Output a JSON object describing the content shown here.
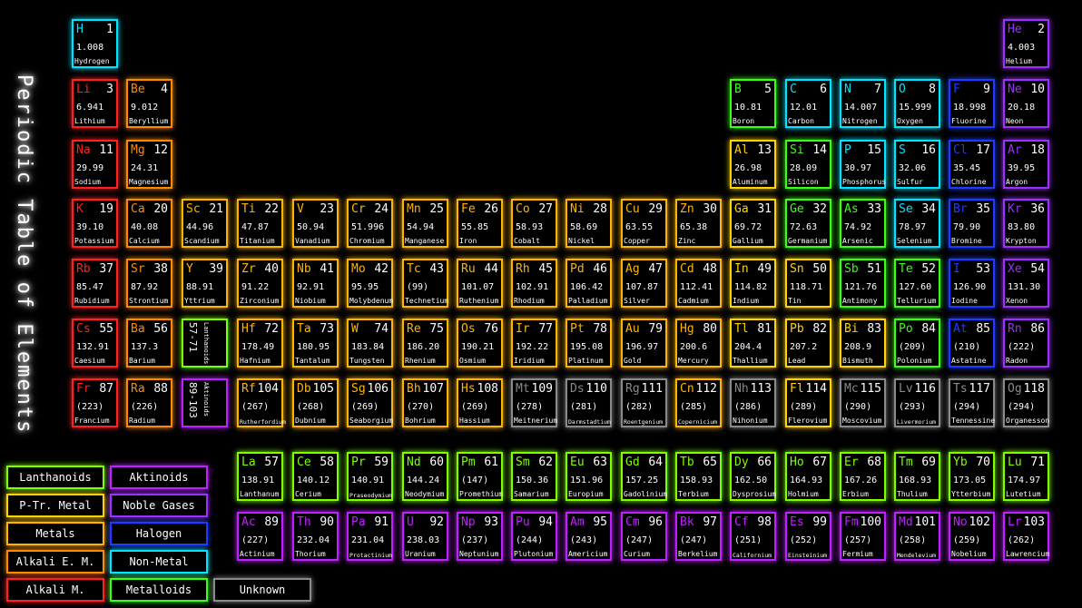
{
  "title": "Periodic Table of Elements",
  "colors": {
    "hydrogen": "#00e5ff",
    "alkali": "#ff2020",
    "alkaline": "#ff8a00",
    "metal": "#ffb400",
    "ptrmetal": "#ffd400",
    "metalloid": "#39ff14",
    "nonmetal": "#00e5ff",
    "halogen": "#1e3cff",
    "noble": "#9b30ff",
    "lanth": "#7dff00",
    "actin": "#c020ff",
    "unknown": "#8a8a8a"
  },
  "elements": [
    {
      "sym": "H",
      "num": "1",
      "mass": "1.008",
      "name": "Hydrogen",
      "cat": "hydrogen"
    },
    {
      "sym": "He",
      "num": "2",
      "mass": "4.003",
      "name": "Helium",
      "cat": "noble"
    },
    {
      "sym": "Li",
      "num": "3",
      "mass": "6.941",
      "name": "Lithium",
      "cat": "alkali"
    },
    {
      "sym": "Be",
      "num": "4",
      "mass": "9.012",
      "name": "Beryllium",
      "cat": "alkaline"
    },
    {
      "sym": "B",
      "num": "5",
      "mass": "10.81",
      "name": "Boron",
      "cat": "metalloid"
    },
    {
      "sym": "C",
      "num": "6",
      "mass": "12.01",
      "name": "Carbon",
      "cat": "nonmetal"
    },
    {
      "sym": "N",
      "num": "7",
      "mass": "14.007",
      "name": "Nitrogen",
      "cat": "nonmetal"
    },
    {
      "sym": "O",
      "num": "8",
      "mass": "15.999",
      "name": "Oxygen",
      "cat": "nonmetal"
    },
    {
      "sym": "F",
      "num": "9",
      "mass": "18.998",
      "name": "Fluorine",
      "cat": "halogen"
    },
    {
      "sym": "Ne",
      "num": "10",
      "mass": "20.18",
      "name": "Neon",
      "cat": "noble"
    },
    {
      "sym": "Na",
      "num": "11",
      "mass": "29.99",
      "name": "Sodium",
      "cat": "alkali"
    },
    {
      "sym": "Mg",
      "num": "12",
      "mass": "24.31",
      "name": "Magnesium",
      "cat": "alkaline"
    },
    {
      "sym": "Al",
      "num": "13",
      "mass": "26.98",
      "name": "Aluminum",
      "cat": "ptrmetal"
    },
    {
      "sym": "Si",
      "num": "14",
      "mass": "28.09",
      "name": "Silicon",
      "cat": "metalloid"
    },
    {
      "sym": "P",
      "num": "15",
      "mass": "30.97",
      "name": "Phosphorus",
      "cat": "nonmetal"
    },
    {
      "sym": "S",
      "num": "16",
      "mass": "32.06",
      "name": "Sulfur",
      "cat": "nonmetal"
    },
    {
      "sym": "Cl",
      "num": "17",
      "mass": "35.45",
      "name": "Chlorine",
      "cat": "halogen"
    },
    {
      "sym": "Ar",
      "num": "18",
      "mass": "39.95",
      "name": "Argon",
      "cat": "noble"
    },
    {
      "sym": "K",
      "num": "19",
      "mass": "39.10",
      "name": "Potassium",
      "cat": "alkali"
    },
    {
      "sym": "Ca",
      "num": "20",
      "mass": "40.08",
      "name": "Calcium",
      "cat": "alkaline"
    },
    {
      "sym": "Sc",
      "num": "21",
      "mass": "44.96",
      "name": "Scandium",
      "cat": "metal"
    },
    {
      "sym": "Ti",
      "num": "22",
      "mass": "47.87",
      "name": "Titanium",
      "cat": "metal"
    },
    {
      "sym": "V",
      "num": "23",
      "mass": "50.94",
      "name": "Vanadium",
      "cat": "metal"
    },
    {
      "sym": "Cr",
      "num": "24",
      "mass": "51.996",
      "name": "Chromium",
      "cat": "metal"
    },
    {
      "sym": "Mn",
      "num": "25",
      "mass": "54.94",
      "name": "Manganese",
      "cat": "metal"
    },
    {
      "sym": "Fe",
      "num": "26",
      "mass": "55.85",
      "name": "Iron",
      "cat": "metal"
    },
    {
      "sym": "Co",
      "num": "27",
      "mass": "58.93",
      "name": "Cobalt",
      "cat": "metal"
    },
    {
      "sym": "Ni",
      "num": "28",
      "mass": "58.69",
      "name": "Nickel",
      "cat": "metal"
    },
    {
      "sym": "Cu",
      "num": "29",
      "mass": "63.55",
      "name": "Copper",
      "cat": "metal"
    },
    {
      "sym": "Zn",
      "num": "30",
      "mass": "65.38",
      "name": "Zinc",
      "cat": "metal"
    },
    {
      "sym": "Ga",
      "num": "31",
      "mass": "69.72",
      "name": "Gallium",
      "cat": "ptrmetal"
    },
    {
      "sym": "Ge",
      "num": "32",
      "mass": "72.63",
      "name": "Germanium",
      "cat": "metalloid"
    },
    {
      "sym": "As",
      "num": "33",
      "mass": "74.92",
      "name": "Arsenic",
      "cat": "metalloid"
    },
    {
      "sym": "Se",
      "num": "34",
      "mass": "78.97",
      "name": "Selenium",
      "cat": "nonmetal"
    },
    {
      "sym": "Br",
      "num": "35",
      "mass": "79.90",
      "name": "Bromine",
      "cat": "halogen"
    },
    {
      "sym": "Kr",
      "num": "36",
      "mass": "83.80",
      "name": "Krypton",
      "cat": "noble"
    },
    {
      "sym": "Rb",
      "num": "37",
      "mass": "85.47",
      "name": "Rubidium",
      "cat": "alkali"
    },
    {
      "sym": "Sr",
      "num": "38",
      "mass": "87.92",
      "name": "Strontium",
      "cat": "alkaline"
    },
    {
      "sym": "Y",
      "num": "39",
      "mass": "88.91",
      "name": "Yttrium",
      "cat": "metal"
    },
    {
      "sym": "Zr",
      "num": "40",
      "mass": "91.22",
      "name": "Zirconium",
      "cat": "metal"
    },
    {
      "sym": "Nb",
      "num": "41",
      "mass": "92.91",
      "name": "Niobium",
      "cat": "metal"
    },
    {
      "sym": "Mo",
      "num": "42",
      "mass": "95.95",
      "name": "Molybdenum",
      "cat": "metal"
    },
    {
      "sym": "Tc",
      "num": "43",
      "mass": "(99)",
      "name": "Technetium",
      "cat": "metal"
    },
    {
      "sym": "Ru",
      "num": "44",
      "mass": "101.07",
      "name": "Ruthenium",
      "cat": "metal"
    },
    {
      "sym": "Rh",
      "num": "45",
      "mass": "102.91",
      "name": "Rhodium",
      "cat": "metal"
    },
    {
      "sym": "Pd",
      "num": "46",
      "mass": "106.42",
      "name": "Palladium",
      "cat": "metal"
    },
    {
      "sym": "Ag",
      "num": "47",
      "mass": "107.87",
      "name": "Silver",
      "cat": "metal"
    },
    {
      "sym": "Cd",
      "num": "48",
      "mass": "112.41",
      "name": "Cadmium",
      "cat": "metal"
    },
    {
      "sym": "In",
      "num": "49",
      "mass": "114.82",
      "name": "Indium",
      "cat": "ptrmetal"
    },
    {
      "sym": "Sn",
      "num": "50",
      "mass": "118.71",
      "name": "Tin",
      "cat": "ptrmetal"
    },
    {
      "sym": "Sb",
      "num": "51",
      "mass": "121.76",
      "name": "Antimony",
      "cat": "metalloid"
    },
    {
      "sym": "Te",
      "num": "52",
      "mass": "127.60",
      "name": "Tellurium",
      "cat": "metalloid"
    },
    {
      "sym": "I",
      "num": "53",
      "mass": "126.90",
      "name": "Iodine",
      "cat": "halogen"
    },
    {
      "sym": "Xe",
      "num": "54",
      "mass": "131.30",
      "name": "Xenon",
      "cat": "noble"
    },
    {
      "sym": "Cs",
      "num": "55",
      "mass": "132.91",
      "name": "Caesium",
      "cat": "alkali"
    },
    {
      "sym": "Ba",
      "num": "56",
      "mass": "137.3",
      "name": "Barium",
      "cat": "alkaline"
    },
    {
      "sym": "57-71",
      "name": "Lanthanoids",
      "cat": "lanth",
      "vertical": true
    },
    {
      "sym": "Hf",
      "num": "72",
      "mass": "178.49",
      "name": "Hafnium",
      "cat": "metal"
    },
    {
      "sym": "Ta",
      "num": "73",
      "mass": "180.95",
      "name": "Tantalum",
      "cat": "metal"
    },
    {
      "sym": "W",
      "num": "74",
      "mass": "183.84",
      "name": "Tungsten",
      "cat": "metal"
    },
    {
      "sym": "Re",
      "num": "75",
      "mass": "186.20",
      "name": "Rhenium",
      "cat": "metal"
    },
    {
      "sym": "Os",
      "num": "76",
      "mass": "190.21",
      "name": "Osmium",
      "cat": "metal"
    },
    {
      "sym": "Ir",
      "num": "77",
      "mass": "192.22",
      "name": "Iridium",
      "cat": "metal"
    },
    {
      "sym": "Pt",
      "num": "78",
      "mass": "195.08",
      "name": "Platinum",
      "cat": "metal"
    },
    {
      "sym": "Au",
      "num": "79",
      "mass": "196.97",
      "name": "Gold",
      "cat": "metal"
    },
    {
      "sym": "Hg",
      "num": "80",
      "mass": "200.6",
      "name": "Mercury",
      "cat": "metal"
    },
    {
      "sym": "Tl",
      "num": "81",
      "mass": "204.4",
      "name": "Thallium",
      "cat": "ptrmetal"
    },
    {
      "sym": "Pb",
      "num": "82",
      "mass": "207.2",
      "name": "Lead",
      "cat": "ptrmetal"
    },
    {
      "sym": "Bi",
      "num": "83",
      "mass": "208.9",
      "name": "Bismuth",
      "cat": "ptrmetal"
    },
    {
      "sym": "Po",
      "num": "84",
      "mass": "(209)",
      "name": "Polonium",
      "cat": "metalloid"
    },
    {
      "sym": "At",
      "num": "85",
      "mass": "(210)",
      "name": "Astatine",
      "cat": "halogen"
    },
    {
      "sym": "Rn",
      "num": "86",
      "mass": "(222)",
      "name": "Radon",
      "cat": "noble"
    },
    {
      "sym": "Fr",
      "num": "87",
      "mass": "(223)",
      "name": "Francium",
      "cat": "alkali"
    },
    {
      "sym": "Ra",
      "num": "88",
      "mass": "(226)",
      "name": "Radium",
      "cat": "alkaline"
    },
    {
      "sym": "89-103",
      "name": "Aktinoids",
      "cat": "actin",
      "vertical": true
    },
    {
      "sym": "Rf",
      "num": "104",
      "mass": "(267)",
      "name": "Rutherfordium",
      "cat": "metal"
    },
    {
      "sym": "Db",
      "num": "105",
      "mass": "(268)",
      "name": "Dubnium",
      "cat": "metal"
    },
    {
      "sym": "Sg",
      "num": "106",
      "mass": "(269)",
      "name": "Seaborgium",
      "cat": "metal"
    },
    {
      "sym": "Bh",
      "num": "107",
      "mass": "(270)",
      "name": "Bohrium",
      "cat": "metal"
    },
    {
      "sym": "Hs",
      "num": "108",
      "mass": "(269)",
      "name": "Hassium",
      "cat": "metal"
    },
    {
      "sym": "Mt",
      "num": "109",
      "mass": "(278)",
      "name": "Meitnerium",
      "cat": "unknown"
    },
    {
      "sym": "Ds",
      "num": "110",
      "mass": "(281)",
      "name": "Darmstadtium",
      "cat": "unknown"
    },
    {
      "sym": "Rg",
      "num": "111",
      "mass": "(282)",
      "name": "Roentgenium",
      "cat": "unknown"
    },
    {
      "sym": "Cn",
      "num": "112",
      "mass": "(285)",
      "name": "Copernicium",
      "cat": "metal"
    },
    {
      "sym": "Nh",
      "num": "113",
      "mass": "(286)",
      "name": "Nihonium",
      "cat": "unknown"
    },
    {
      "sym": "Fl",
      "num": "114",
      "mass": "(289)",
      "name": "Flerovium",
      "cat": "ptrmetal"
    },
    {
      "sym": "Mc",
      "num": "115",
      "mass": "(290)",
      "name": "Moscovium",
      "cat": "unknown"
    },
    {
      "sym": "Lv",
      "num": "116",
      "mass": "(293)",
      "name": "Livermorium",
      "cat": "unknown"
    },
    {
      "sym": "Ts",
      "num": "117",
      "mass": "(294)",
      "name": "Tennessine",
      "cat": "unknown"
    },
    {
      "sym": "Og",
      "num": "118",
      "mass": "(294)",
      "name": "Organesson",
      "cat": "unknown"
    },
    {
      "sym": "La",
      "num": "57",
      "mass": "138.91",
      "name": "Lanthanum",
      "cat": "lanth"
    },
    {
      "sym": "Ce",
      "num": "58",
      "mass": "140.12",
      "name": "Cerium",
      "cat": "lanth"
    },
    {
      "sym": "Pr",
      "num": "59",
      "mass": "140.91",
      "name": "Praseodymium",
      "cat": "lanth"
    },
    {
      "sym": "Nd",
      "num": "60",
      "mass": "144.24",
      "name": "Neodymium",
      "cat": "lanth"
    },
    {
      "sym": "Pm",
      "num": "61",
      "mass": "(147)",
      "name": "Promethium",
      "cat": "lanth"
    },
    {
      "sym": "Sm",
      "num": "62",
      "mass": "150.36",
      "name": "Samarium",
      "cat": "lanth"
    },
    {
      "sym": "Eu",
      "num": "63",
      "mass": "151.96",
      "name": "Europium",
      "cat": "lanth"
    },
    {
      "sym": "Gd",
      "num": "64",
      "mass": "157.25",
      "name": "Gadolinium",
      "cat": "lanth"
    },
    {
      "sym": "Tb",
      "num": "65",
      "mass": "158.93",
      "name": "Terbium",
      "cat": "lanth"
    },
    {
      "sym": "Dy",
      "num": "66",
      "mass": "162.50",
      "name": "Dysprosium",
      "cat": "lanth"
    },
    {
      "sym": "Ho",
      "num": "67",
      "mass": "164.93",
      "name": "Holmium",
      "cat": "lanth"
    },
    {
      "sym": "Er",
      "num": "68",
      "mass": "167.26",
      "name": "Erbium",
      "cat": "lanth"
    },
    {
      "sym": "Tm",
      "num": "69",
      "mass": "168.93",
      "name": "Thulium",
      "cat": "lanth"
    },
    {
      "sym": "Yb",
      "num": "70",
      "mass": "173.05",
      "name": "Ytterbium",
      "cat": "lanth"
    },
    {
      "sym": "Lu",
      "num": "71",
      "mass": "174.97",
      "name": "Lutetium",
      "cat": "lanth"
    },
    {
      "sym": "Ac",
      "num": "89",
      "mass": "(227)",
      "name": "Actinium",
      "cat": "actin"
    },
    {
      "sym": "Th",
      "num": "90",
      "mass": "232.04",
      "name": "Thorium",
      "cat": "actin"
    },
    {
      "sym": "Pa",
      "num": "91",
      "mass": "231.04",
      "name": "Protactinium",
      "cat": "actin"
    },
    {
      "sym": "U",
      "num": "92",
      "mass": "238.03",
      "name": "Uranium",
      "cat": "actin"
    },
    {
      "sym": "Np",
      "num": "93",
      "mass": "(237)",
      "name": "Neptunium",
      "cat": "actin"
    },
    {
      "sym": "Pu",
      "num": "94",
      "mass": "(244)",
      "name": "Plutonium",
      "cat": "actin"
    },
    {
      "sym": "Am",
      "num": "95",
      "mass": "(243)",
      "name": "Americium",
      "cat": "actin"
    },
    {
      "sym": "Cm",
      "num": "96",
      "mass": "(247)",
      "name": "Curium",
      "cat": "actin"
    },
    {
      "sym": "Bk",
      "num": "97",
      "mass": "(247)",
      "name": "Berkelium",
      "cat": "actin"
    },
    {
      "sym": "Cf",
      "num": "98",
      "mass": "(251)",
      "name": "Californium",
      "cat": "actin"
    },
    {
      "sym": "Es",
      "num": "99",
      "mass": "(252)",
      "name": "Einsteinium",
      "cat": "actin"
    },
    {
      "sym": "Fm",
      "num": "100",
      "mass": "(257)",
      "name": "Fermium",
      "cat": "actin"
    },
    {
      "sym": "Md",
      "num": "101",
      "mass": "(258)",
      "name": "Mendelevium",
      "cat": "actin"
    },
    {
      "sym": "No",
      "num": "102",
      "mass": "(259)",
      "name": "Nobelium",
      "cat": "actin"
    },
    {
      "sym": "Lr",
      "num": "103",
      "mass": "(262)",
      "name": "Lawrencium",
      "cat": "actin"
    }
  ],
  "legend": [
    {
      "label": "Lanthanoids",
      "cat": "lanth"
    },
    {
      "label": "Aktinoids",
      "cat": "actin"
    },
    {
      "label": "P-Tr. Metal",
      "cat": "ptrmetal"
    },
    {
      "label": "Noble Gases",
      "cat": "noble"
    },
    {
      "label": "Metals",
      "cat": "metal"
    },
    {
      "label": "Halogen",
      "cat": "halogen"
    },
    {
      "label": "Alkali E. M.",
      "cat": "alkaline"
    },
    {
      "label": "Non-Metal",
      "cat": "nonmetal"
    },
    {
      "label": "Alkali M.",
      "cat": "alkali"
    },
    {
      "label": "Metalloids",
      "cat": "metalloid"
    },
    {
      "label": "Unknown",
      "cat": "unknown"
    }
  ]
}
